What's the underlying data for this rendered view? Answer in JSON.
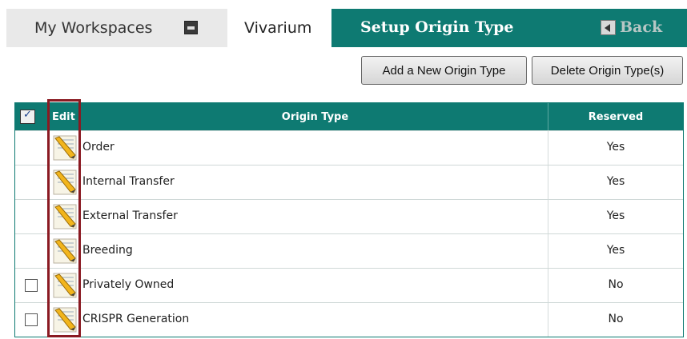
{
  "nav": {
    "workspaces_label": "My Workspaces",
    "module_label": "Vivarium",
    "page_title": "Setup Origin Type",
    "back_label": "Back"
  },
  "actions": {
    "add_label": "Add a New Origin Type",
    "delete_label": "Delete Origin Type(s)"
  },
  "table": {
    "headers": {
      "edit": "Edit",
      "origin_type": "Origin Type",
      "reserved": "Reserved"
    },
    "rows": [
      {
        "name": "Order",
        "reserved": "Yes",
        "selectable": false
      },
      {
        "name": "Internal Transfer",
        "reserved": "Yes",
        "selectable": false
      },
      {
        "name": "External Transfer",
        "reserved": "Yes",
        "selectable": false
      },
      {
        "name": "Breeding",
        "reserved": "Yes",
        "selectable": false
      },
      {
        "name": "Privately Owned",
        "reserved": "No",
        "selectable": true
      },
      {
        "name": "CRISPR Generation",
        "reserved": "No",
        "selectable": true
      }
    ]
  },
  "colors": {
    "header_teal": "#0e7a72",
    "highlight_red": "#8a1a22"
  },
  "icons": [
    "dropdown-icon",
    "back-arrow-icon",
    "select-all-icon",
    "edit-icon"
  ]
}
